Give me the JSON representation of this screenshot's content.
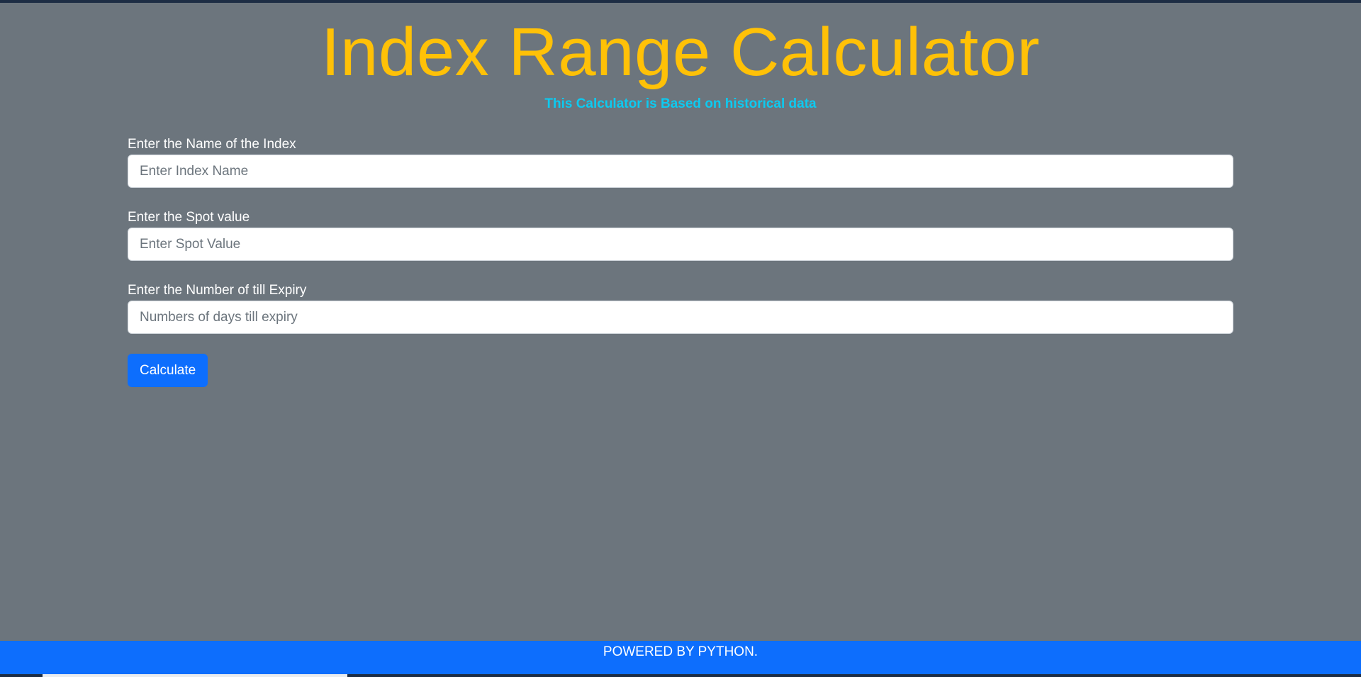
{
  "header": {
    "title": "Index Range Calculator",
    "subtitle": "This Calculator is Based on historical data"
  },
  "form": {
    "index_name": {
      "label": "Enter the Name of the Index",
      "placeholder": "Enter Index Name",
      "value": ""
    },
    "spot_value": {
      "label": "Enter the Spot value",
      "placeholder": "Enter Spot Value",
      "value": ""
    },
    "days_to_expiry": {
      "label": "Enter the Number of till Expiry",
      "placeholder": "Numbers of days till expiry",
      "value": ""
    },
    "submit_label": "Calculate"
  },
  "footer": {
    "text": "POWERED BY PYTHON."
  },
  "colors": {
    "background": "#6c757d",
    "title": "#ffc107",
    "subtitle": "#0dcaf0",
    "primary": "#0d6efd"
  }
}
